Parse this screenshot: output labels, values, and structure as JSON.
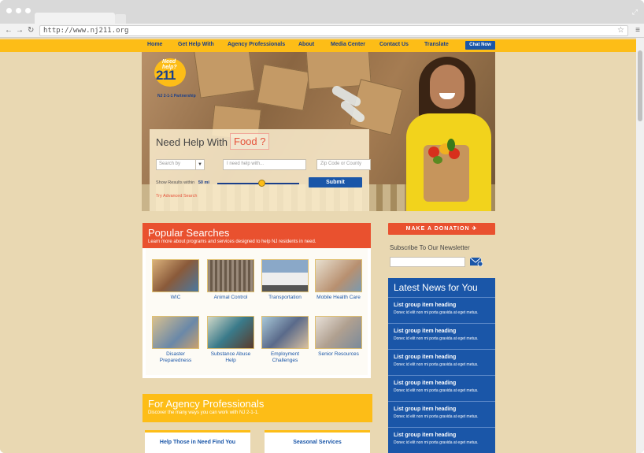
{
  "browser": {
    "url": "http://www.nj211.org"
  },
  "nav": {
    "items": [
      "Home",
      "Get Help With",
      "Agency Professionals",
      "About",
      "Media Center",
      "Contact Us",
      "Translate"
    ],
    "chat_label": "Chat Now"
  },
  "logo": {
    "need_help": "Need help?",
    "number": "211",
    "partnership": "NJ 2-1-1 Partnership"
  },
  "search": {
    "heading": "Need Help With",
    "highlight": "Food ?",
    "search_by_placeholder": "Search by",
    "query_placeholder": "I need help with...",
    "zip_placeholder": "Zip Code or County",
    "show_results_label": "Show Results within",
    "radius_value": "50 mi",
    "submit_label": "Submit",
    "advanced_link": "Try Advanced Search"
  },
  "popular": {
    "title": "Popular Searches",
    "subtitle": "Learn more about programs and services designed to help NJ residents in need.",
    "tiles": [
      {
        "label": "WIC"
      },
      {
        "label": "Animal Control"
      },
      {
        "label": "Transportation"
      },
      {
        "label": "Mobile Health Care"
      },
      {
        "label": "Disaster Preparedness"
      },
      {
        "label": "Substance Abuse Help"
      },
      {
        "label": "Employment Challenges"
      },
      {
        "label": "Senior Resources"
      }
    ]
  },
  "agency": {
    "title": "For Agency Professionals",
    "subtitle": "Discover the many ways you can work with NJ 2-1-1.",
    "cards": [
      "Help Those in Need Find You",
      "Seasonal Services"
    ]
  },
  "sidebar": {
    "donate_label": "MAKE A DONATION",
    "newsletter_label": "Subscribe To Our Newsletter",
    "news_title": "Latest News for You",
    "news_items": [
      {
        "heading": "List group item heading",
        "desc": "Donec id elit non mi porta gravida at eget metus."
      },
      {
        "heading": "List group item heading",
        "desc": "Donec id elit non mi porta gravida at eget metus."
      },
      {
        "heading": "List group item heading",
        "desc": "Donec id elit non mi porta gravida at eget metus."
      },
      {
        "heading": "List group item heading",
        "desc": "Donec id elit non mi porta gravida at eget metus."
      },
      {
        "heading": "List group item heading",
        "desc": "Donec id elit non mi porta gravida at eget metus."
      },
      {
        "heading": "List group item heading",
        "desc": "Donec id elit non mi porta gravida at eget metus."
      }
    ]
  },
  "colors": {
    "accent_yellow": "#fdbd17",
    "accent_orange": "#e9512f",
    "brand_blue": "#1a56a8",
    "page_bg": "#e9d8b2"
  }
}
